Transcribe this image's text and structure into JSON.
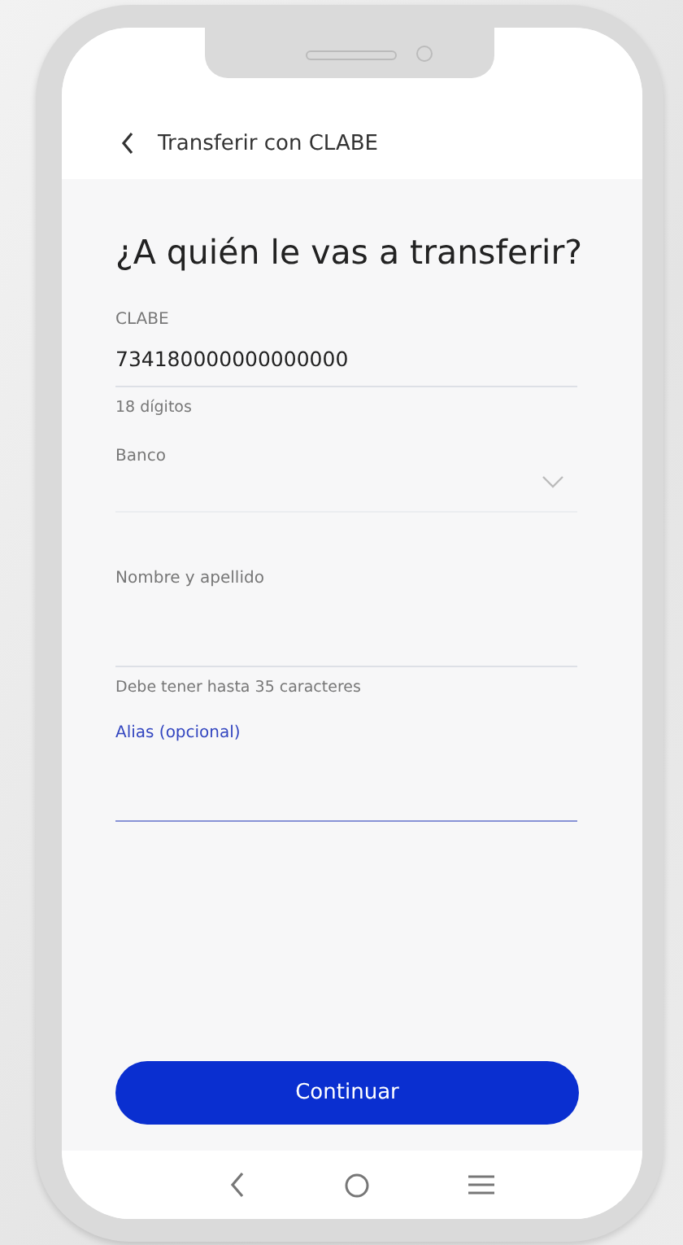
{
  "header": {
    "title": "Transferir con CLABE"
  },
  "heading": "¿A quién le vas a transferir?",
  "fields": [
    {
      "kind": "text",
      "label": "CLABE",
      "value": "734180000000000000",
      "helper": "18 dígitos",
      "focused": false
    },
    {
      "kind": "select",
      "label": "Banco",
      "focused": false
    },
    {
      "kind": "text",
      "label": "Nombre y apellido",
      "helper": "Debe tener hasta 35 caracteres",
      "focused": false
    },
    {
      "kind": "text",
      "label": "Alias (opcional)",
      "focused": true
    }
  ],
  "button": {
    "label": "Continuar"
  }
}
